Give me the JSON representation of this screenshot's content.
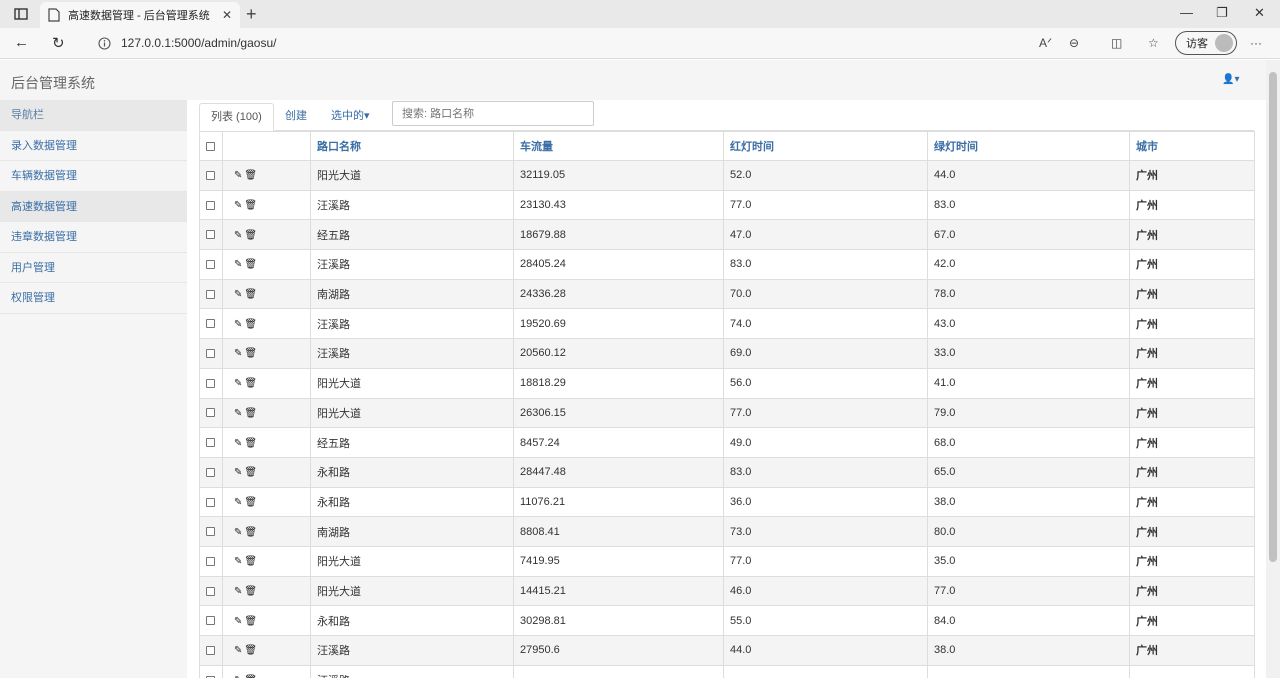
{
  "browser": {
    "tab_title": "高速数据管理 - 后台管理系统",
    "url": "127.0.0.1:5000/admin/gaosu/",
    "guest_label": "访客"
  },
  "app": {
    "title": "后台管理系统"
  },
  "sidebar": {
    "header": "导航栏",
    "items": [
      {
        "label": "录入数据管理"
      },
      {
        "label": "车辆数据管理"
      },
      {
        "label": "高速数据管理"
      },
      {
        "label": "违章数据管理"
      },
      {
        "label": "用户管理"
      },
      {
        "label": "权限管理"
      }
    ]
  },
  "tabs": {
    "list": "列表 (100)",
    "create": "创建",
    "selected": "选中的"
  },
  "search": {
    "placeholder": "搜索: 路口名称"
  },
  "table": {
    "columns": [
      "路口名称",
      "车流量",
      "红灯时间",
      "绿灯时间",
      "城市"
    ],
    "rows": [
      [
        "阳光大道",
        "32119.05",
        "52.0",
        "44.0",
        "广州"
      ],
      [
        "汪溪路",
        "23130.43",
        "77.0",
        "83.0",
        "广州"
      ],
      [
        "经五路",
        "18679.88",
        "47.0",
        "67.0",
        "广州"
      ],
      [
        "汪溪路",
        "28405.24",
        "83.0",
        "42.0",
        "广州"
      ],
      [
        "南湖路",
        "24336.28",
        "70.0",
        "78.0",
        "广州"
      ],
      [
        "汪溪路",
        "19520.69",
        "74.0",
        "43.0",
        "广州"
      ],
      [
        "汪溪路",
        "20560.12",
        "69.0",
        "33.0",
        "广州"
      ],
      [
        "阳光大道",
        "18818.29",
        "56.0",
        "41.0",
        "广州"
      ],
      [
        "阳光大道",
        "26306.15",
        "77.0",
        "79.0",
        "广州"
      ],
      [
        "经五路",
        "8457.24",
        "49.0",
        "68.0",
        "广州"
      ],
      [
        "永和路",
        "28447.48",
        "83.0",
        "65.0",
        "广州"
      ],
      [
        "永和路",
        "11076.21",
        "36.0",
        "38.0",
        "广州"
      ],
      [
        "南湖路",
        "8808.41",
        "73.0",
        "80.0",
        "广州"
      ],
      [
        "阳光大道",
        "7419.95",
        "77.0",
        "35.0",
        "广州"
      ],
      [
        "阳光大道",
        "14415.21",
        "46.0",
        "77.0",
        "广州"
      ],
      [
        "永和路",
        "30298.81",
        "55.0",
        "84.0",
        "广州"
      ],
      [
        "汪溪路",
        "27950.6",
        "44.0",
        "38.0",
        "广州"
      ],
      [
        "汪溪路",
        "",
        "",
        "",
        ""
      ]
    ]
  }
}
